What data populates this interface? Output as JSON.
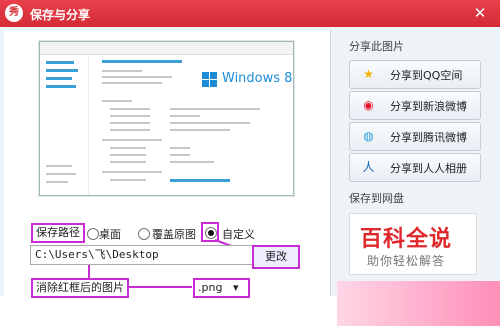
{
  "window": {
    "title": "保存与分享",
    "app_icon_text": "秀",
    "close_glyph": "✕"
  },
  "preview": {
    "product_text": "Windows 8"
  },
  "save": {
    "path_label": "保存路径",
    "options": [
      {
        "label": "桌面"
      },
      {
        "label": "覆盖原图"
      },
      {
        "label": "自定义"
      }
    ],
    "path_value": "C:\\Users\\飞\\Desktop",
    "change_button": "更改",
    "filename_label": "消除红框后的图片",
    "format_value": ".png",
    "format_arrow": "▾"
  },
  "share": {
    "heading": "分享此图片",
    "buttons": [
      {
        "label": "分享到QQ空间",
        "icon": "star-icon",
        "glyph": "★",
        "color": "#f6b400"
      },
      {
        "label": "分享到新浪微博",
        "icon": "weibo-icon",
        "glyph": "◉",
        "color": "#e6162d"
      },
      {
        "label": "分享到腾讯微博",
        "icon": "tencent-weibo-icon",
        "glyph": "◍",
        "color": "#2aa0d8"
      },
      {
        "label": "分享到人人相册",
        "icon": "renren-icon",
        "glyph": "人",
        "color": "#1166bb"
      }
    ],
    "save_cloud_heading": "保存到网盘"
  },
  "promo": {
    "title": "百科全说",
    "subtitle": "助你轻松解答"
  },
  "colors": {
    "title_bar": "#d42b35",
    "annotation": "#c92bd6",
    "promo_red": "#e0282c"
  }
}
